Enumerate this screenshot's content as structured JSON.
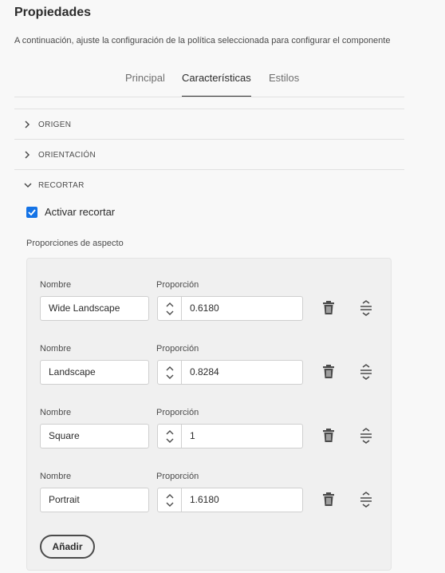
{
  "header": {
    "title": "Propiedades",
    "subtitle": "A continuación, ajuste la configuración de la política seleccionada para configurar el componente"
  },
  "tabs": [
    {
      "label": "Principal",
      "active": false
    },
    {
      "label": "Características",
      "active": true
    },
    {
      "label": "Estilos",
      "active": false
    }
  ],
  "accordion": [
    {
      "label": "ORIGEN",
      "expanded": false,
      "icon": "chevron-right-icon"
    },
    {
      "label": "ORIENTACIÓN",
      "expanded": false,
      "icon": "chevron-right-icon"
    },
    {
      "label": "RECORTAR",
      "expanded": true,
      "icon": "chevron-down-icon"
    }
  ],
  "crop": {
    "enable_label": "Activar recortar",
    "enabled": true,
    "aspect_ratios_label": "Proporciones de aspecto",
    "name_label": "Nombre",
    "ratio_label": "Proporción",
    "rows": [
      {
        "name": "Wide Landscape",
        "ratio": "0.6180"
      },
      {
        "name": "Landscape",
        "ratio": "0.8284"
      },
      {
        "name": "Square",
        "ratio": "1"
      },
      {
        "name": "Portrait",
        "ratio": "1.6180"
      }
    ],
    "add_label": "Añadir"
  },
  "colors": {
    "accent": "#1473e6",
    "text": "#2c2c2c",
    "background": "#f8f8f8"
  }
}
